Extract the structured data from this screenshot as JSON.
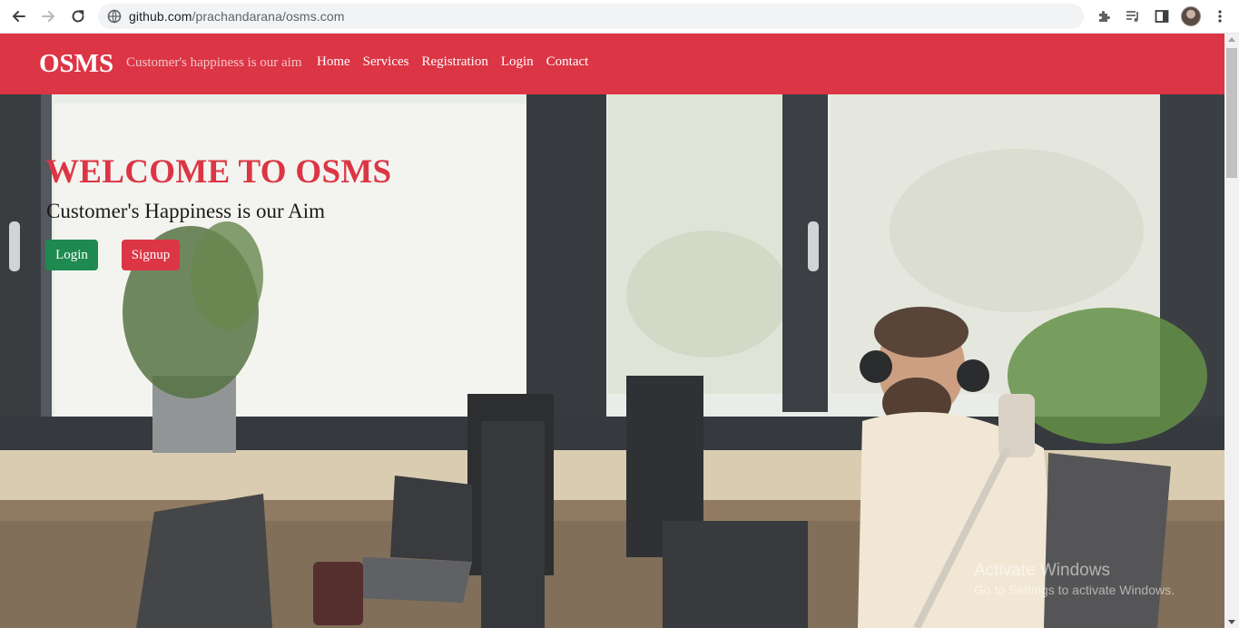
{
  "browser": {
    "url_host": "github.com",
    "url_path": "/prachandarana/osms.com"
  },
  "navbar": {
    "brand": "OSMS",
    "tagline": "Customer's happiness is our aim",
    "links": [
      "Home",
      "Services",
      "Registration",
      "Login",
      "Contact"
    ]
  },
  "hero": {
    "title": "WELCOME TO OSMS",
    "subtitle": "Customer's Happiness is our Aim",
    "login_label": "Login",
    "signup_label": "Signup"
  },
  "watermark": {
    "title": "Activate Windows",
    "subtitle": "Go to Settings to activate Windows."
  },
  "colors": {
    "accent": "#dc3545",
    "success": "#1e8a4f"
  }
}
